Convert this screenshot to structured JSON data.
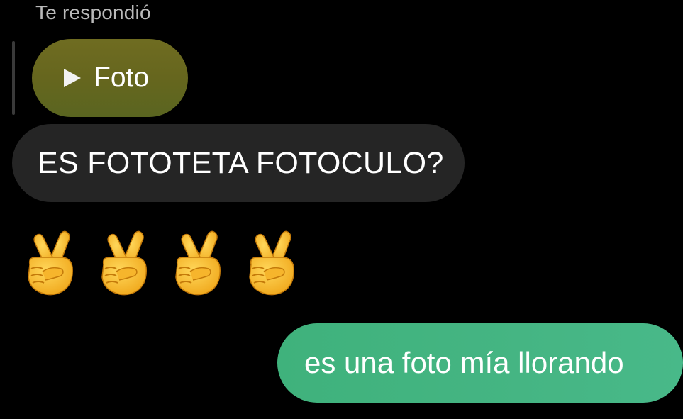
{
  "reply": {
    "label": "Te respondió",
    "quoted_message": {
      "icon": "play-icon",
      "text": "Foto"
    }
  },
  "messages": [
    {
      "direction": "received",
      "text": "ES FOTOTETA FOTOCULO?"
    },
    {
      "direction": "received",
      "type": "emoji",
      "emoji": "crossed-fingers-icon",
      "count": 4
    },
    {
      "direction": "sent",
      "text": "es una foto mía llorando"
    }
  ],
  "colors": {
    "background": "#000000",
    "quoted_bubble": "#66661e",
    "received_bubble": "#252525",
    "sent_bubble": "#45b583"
  }
}
